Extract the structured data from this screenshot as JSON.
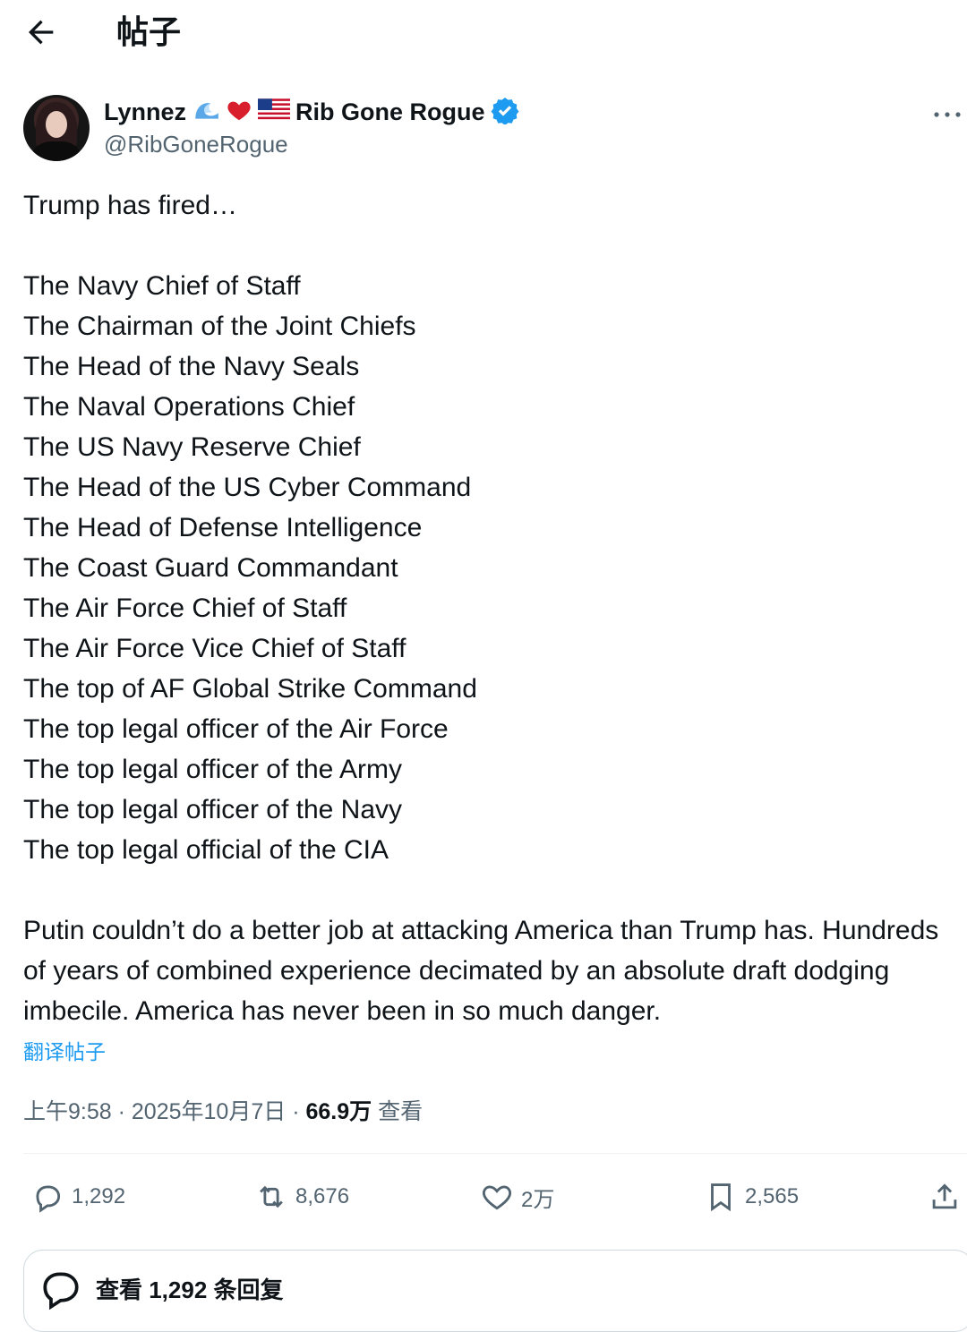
{
  "header": {
    "title": "帖子",
    "back_icon": "arrow-left-icon"
  },
  "author": {
    "display_name": "Lynnez",
    "emojis": [
      "🌊",
      "❤️",
      "🇺🇸"
    ],
    "name_suffix": "Rib Gone Rogue",
    "handle": "@RibGoneRogue",
    "verified": true,
    "verified_color": "#1d9bf0"
  },
  "tweet": {
    "text": "Trump has fired…\n\nThe Navy Chief of Staff\nThe Chairman of the Joint Chiefs\nThe Head of the Navy Seals\nThe Naval Operations Chief\nThe US Navy Reserve Chief\nThe Head of the US Cyber Command\nThe Head of Defense Intelligence\nThe Coast Guard Commandant\nThe Air Force Chief of Staff\nThe Air Force Vice Chief of Staff\nThe top of AF Global Strike Command\nThe top legal officer of the Air Force\nThe top legal officer of the Army\nThe top legal officer of the Navy\nThe top legal official of the CIA\n\nPutin couldn’t do a better job at attacking America than Trump has. Hundreds of years of combined experience decimated by an absolute draft dodging imbecile. America has never been in so much danger.",
    "translate_label": "翻译帖子"
  },
  "meta": {
    "time": "上午9:58",
    "date": "2025年10月7日",
    "views_count": "66.9万",
    "views_label": "查看"
  },
  "actions": {
    "replies": "1,292",
    "reposts": "8,676",
    "likes": "2万",
    "bookmarks": "2,565"
  },
  "reply_prompt": {
    "label": "查看 1,292 条回复"
  },
  "colors": {
    "accent": "#1d9bf0",
    "muted": "#536471",
    "text": "#0f1419",
    "heart": "#d81e2c"
  }
}
